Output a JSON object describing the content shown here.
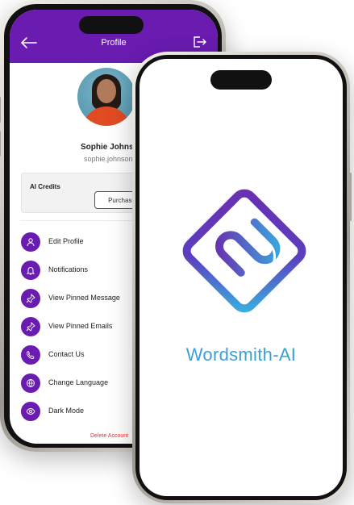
{
  "profile_screen": {
    "title": "Profile",
    "user_name": "Sophie Johns",
    "user_email": "sophie.johnson@gm",
    "credits_label": "AI Credits",
    "purchase_label": "Purchase",
    "menu_items": [
      {
        "label": "Edit Profile",
        "icon": "user-icon"
      },
      {
        "label": "Notifications",
        "icon": "bell-icon"
      },
      {
        "label": "View Pinned Message",
        "icon": "pin-icon"
      },
      {
        "label": "View Pinned Emails",
        "icon": "pin-icon"
      },
      {
        "label": "Contact Us",
        "icon": "phone-icon"
      },
      {
        "label": "Change Language",
        "icon": "globe-icon"
      },
      {
        "label": "Dark Mode",
        "icon": "eye-icon"
      }
    ],
    "delete_account_label": "Delete Account",
    "colors": {
      "header": "#6a1bb0",
      "accent": "#6a1bb0",
      "danger": "#ee3333"
    }
  },
  "splash_screen": {
    "app_name": "Wordsmith-AI",
    "logo_icon": "wordsmith-logo",
    "colors": {
      "gradient_start": "#6a2fb0",
      "gradient_end": "#3ab0e0"
    }
  }
}
